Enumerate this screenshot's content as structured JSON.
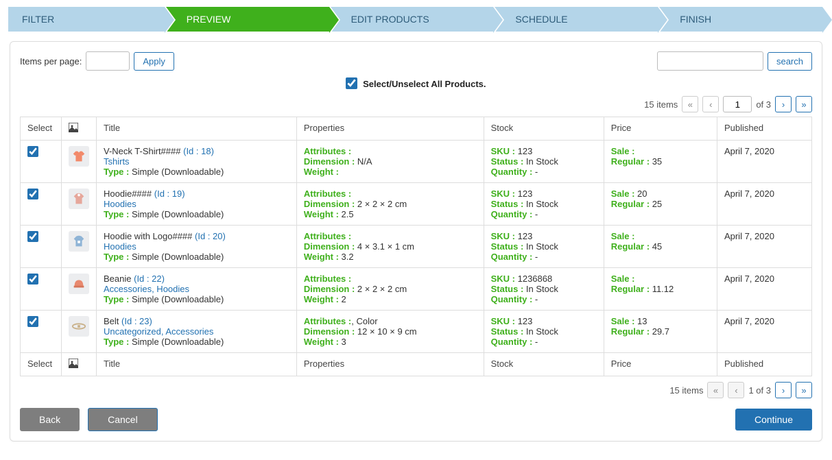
{
  "wizard": {
    "steps": [
      "FILTER",
      "PREVIEW",
      "EDIT PRODUCTS",
      "SCHEDULE",
      "FINISH"
    ],
    "active_index": 1
  },
  "toolbar": {
    "items_per_page_label": "Items per page:",
    "apply_label": "Apply",
    "search_label": "search"
  },
  "select_all": {
    "label": "Select/Unselect All Products.",
    "checked": true
  },
  "pager": {
    "total_text": "15 items",
    "page": "1",
    "of_text": "of 3",
    "page_text": "1 of 3"
  },
  "table": {
    "headers": {
      "select": "Select",
      "title": "Title",
      "properties": "Properties",
      "stock": "Stock",
      "price": "Price",
      "published": "Published"
    },
    "label_attributes": "Attributes :",
    "label_dimension": "Dimension :",
    "label_weight": "Weight :",
    "label_sku": "SKU :",
    "label_status": "Status :",
    "label_quantity": "Quantity :",
    "label_sale": "Sale :",
    "label_regular": "Regular :",
    "label_type": "Type :",
    "label_id": "(Id :",
    "rows": [
      {
        "checked": true,
        "thumb": "tshirt",
        "title": "V-Neck T-Shirt####",
        "id": "18",
        "id_close": ")",
        "categories": "Tshirts",
        "type": "Simple (Downloadable)",
        "attributes": "",
        "dimension": "N/A",
        "weight": "",
        "sku": "123",
        "status": "In Stock",
        "quantity": "-",
        "sale": "",
        "regular": "35",
        "published": "April 7, 2020"
      },
      {
        "checked": true,
        "thumb": "hoodie",
        "title": "Hoodie####",
        "id": "19",
        "id_close": ")",
        "categories": "Hoodies",
        "type": "Simple (Downloadable)",
        "attributes": "",
        "dimension": "2 × 2 × 2 cm",
        "weight": "2.5",
        "sku": "123",
        "status": "In Stock",
        "quantity": "-",
        "sale": "20",
        "regular": "25",
        "published": "April 7, 2020"
      },
      {
        "checked": true,
        "thumb": "hoodie-logo",
        "title": "Hoodie with Logo####",
        "id": "20",
        "id_close": ")",
        "categories": "Hoodies",
        "type": "Simple (Downloadable)",
        "attributes": "",
        "dimension": "4 × 3.1 × 1 cm",
        "weight": "3.2",
        "sku": "123",
        "status": "In Stock",
        "quantity": "-",
        "sale": "",
        "regular": "45",
        "published": "April 7, 2020"
      },
      {
        "checked": true,
        "thumb": "beanie",
        "title": "Beanie",
        "id": "22",
        "id_close": ")",
        "categories": "Accessories, Hoodies",
        "type": "Simple (Downloadable)",
        "attributes": "",
        "dimension": "2 × 2 × 2 cm",
        "weight": "2",
        "sku": "1236868",
        "status": "In Stock",
        "quantity": "-",
        "sale": "",
        "regular": "11.12",
        "published": "April 7, 2020"
      },
      {
        "checked": true,
        "thumb": "belt",
        "title": "Belt",
        "id": "23",
        "id_close": ")",
        "categories": "Uncategorized, Accessories",
        "type": "Simple (Downloadable)",
        "attributes": ", Color",
        "dimension": "12 × 10 × 9 cm",
        "weight": "3",
        "sku": "123",
        "status": "In Stock",
        "quantity": "-",
        "sale": "13",
        "regular": "29.7",
        "published": "April 7, 2020"
      }
    ]
  },
  "footer": {
    "back": "Back",
    "cancel": "Cancel",
    "continue": "Continue"
  }
}
